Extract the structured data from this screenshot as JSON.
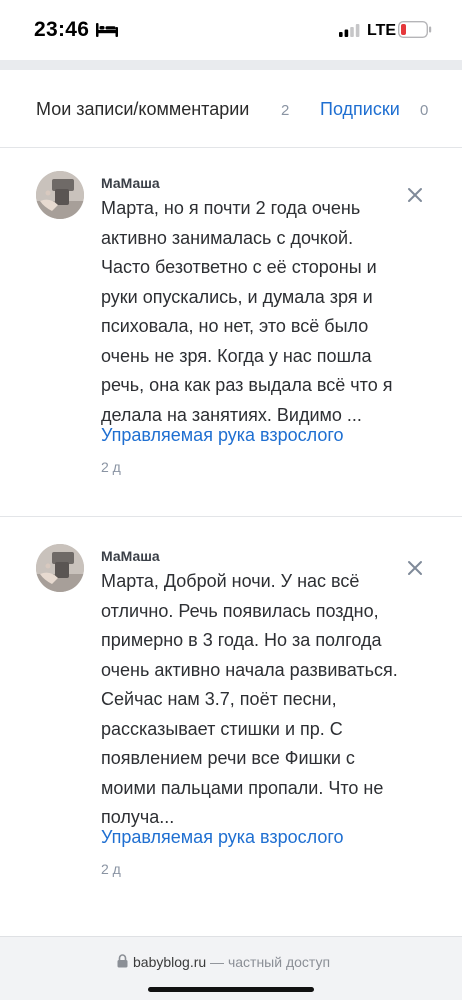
{
  "status_bar": {
    "time": "23:46",
    "network": "LTE",
    "icons": [
      "bed-icon",
      "signal-icon",
      "battery-icon"
    ]
  },
  "tabs": {
    "my_records_label": "Мои записи/комментарии",
    "my_records_count": "2",
    "subscriptions_label": "Подписки",
    "subscriptions_count": "0"
  },
  "comments": [
    {
      "author": "МаМаша",
      "text": "Марта, но я почти 2 года очень активно занималась с дочкой. Часто безответно с её стороны и руки опускались, и думала зря и психовала, но нет, это всё было очень не зря. Когда у нас пошла речь, она как раз выдала всё что я делала на занятиях. Видимо ...",
      "post_link": "Управляемая рука взрослого",
      "time": "2 д"
    },
    {
      "author": "МаМаша",
      "text": "Марта, Доброй ночи. У нас всё отлично. Речь появилась поздно, примерно в 3 года. Но за полгода очень активно начала развиваться. Сейчас нам 3.7, поёт песни, рассказывает стишки и пр. С появлением речи все Фишки с моими пальцами пропали. Что не получа...",
      "post_link": "Управляемая рука взрослого",
      "time": "2 д"
    }
  ],
  "browser_bar": {
    "domain": "babyblog.ru",
    "suffix": " — частный доступ"
  },
  "colors": {
    "accent": "#1f6fd1",
    "muted": "#8a94a3",
    "battery_low": "#e5383b"
  }
}
